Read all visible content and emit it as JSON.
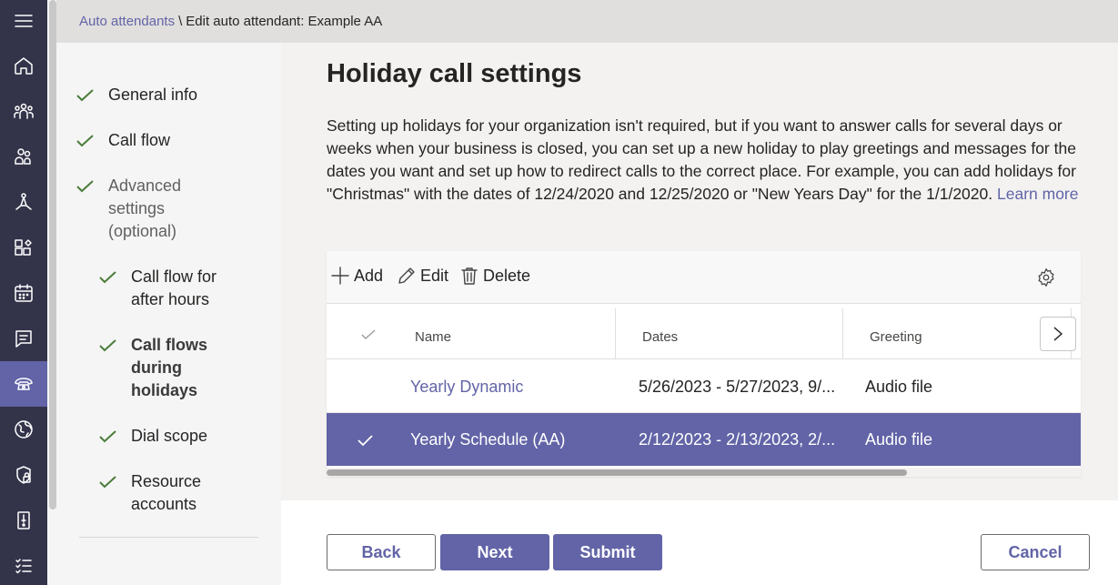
{
  "breadcrumb": {
    "link": "Auto attendants",
    "separator": "\\",
    "current": "Edit auto attendant: Example AA"
  },
  "rail": {
    "icons": [
      "menu-icon",
      "home-icon",
      "teams-icon",
      "users-icon",
      "meetings-icon",
      "apps-icon",
      "calendar-icon",
      "messaging-icon",
      "voice-icon",
      "locations-icon",
      "security-icon",
      "policy-icon",
      "planning-icon"
    ],
    "active": "voice-icon"
  },
  "steps": [
    {
      "label": "General info"
    },
    {
      "label": "Call flow"
    },
    {
      "label_lines": [
        "Advanced",
        "settings",
        "(optional)"
      ]
    },
    {
      "label_lines": [
        "Call flow for",
        "after hours"
      ]
    },
    {
      "label_lines": [
        "Call flows",
        "during",
        "holidays"
      ]
    },
    {
      "label": "Dial scope"
    },
    {
      "label_lines": [
        "Resource",
        "accounts"
      ]
    }
  ],
  "main": {
    "title": "Holiday call settings",
    "description": "Setting up holidays for your organization isn't required, but if you want to answer calls for several days or weeks when your business is closed, you can set up a new holiday to play greetings and messages for the dates you want and set up how to redirect calls to the correct place. For example, you can add holidays for \"Christmas\" with the dates of 12/24/2020 and 12/25/2020 or \"New Years Day\" for the 1/1/2020.",
    "learn_more": "Learn more"
  },
  "toolbar": {
    "add": "Add",
    "edit": "Edit",
    "delete": "Delete"
  },
  "table": {
    "columns": [
      "Name",
      "Dates",
      "Greeting"
    ],
    "rows": [
      {
        "name": "Yearly Dynamic",
        "dates": "5/26/2023 - 5/27/2023, 9/...",
        "greeting": "Audio file",
        "selected": false
      },
      {
        "name": "Yearly Schedule (AA)",
        "dates": "2/12/2023 - 2/13/2023, 2/...",
        "greeting": "Audio file",
        "selected": true
      }
    ]
  },
  "footer": {
    "back": "Back",
    "next": "Next",
    "submit": "Submit",
    "cancel": "Cancel"
  },
  "colors": {
    "accent": "#6264a7",
    "rail": "#33344a",
    "check": "#4a7c3a"
  }
}
